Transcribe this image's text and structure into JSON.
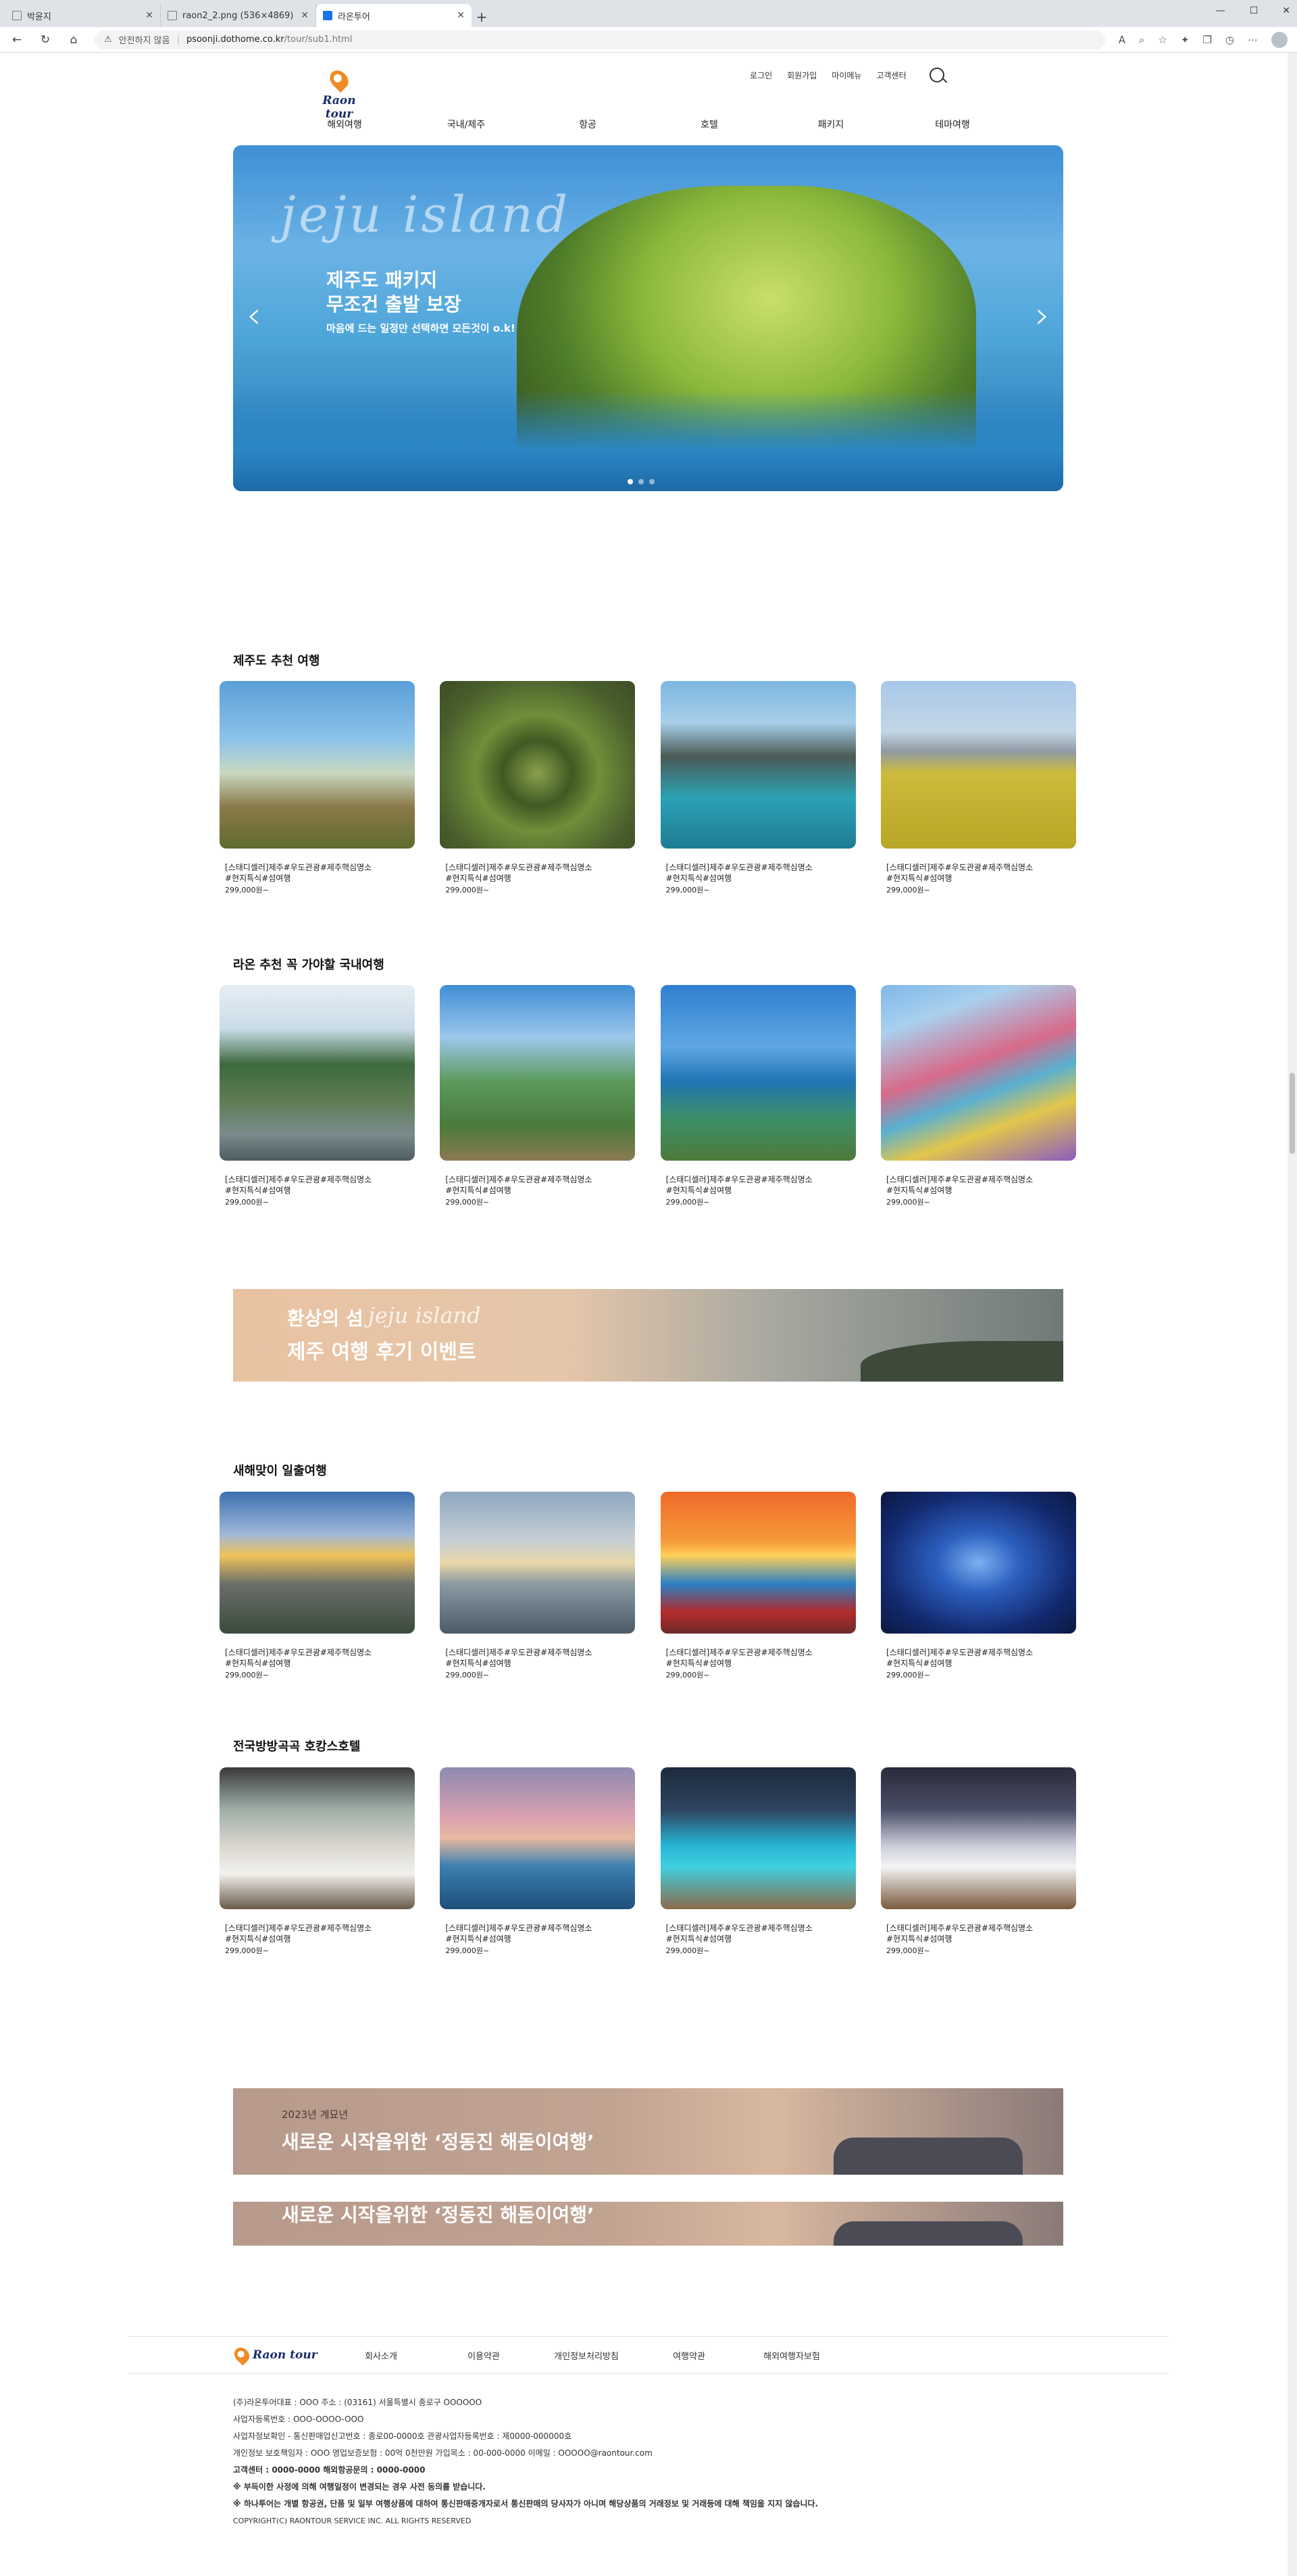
{
  "browser": {
    "tabs": [
      {
        "title": "박윤지",
        "active": false
      },
      {
        "title": "raon2_2.png (536×4869)",
        "active": false
      },
      {
        "title": "라온투어",
        "active": true
      }
    ],
    "security_label": "안전하지 않음",
    "url_host": "psoonji.dothome.co.kr",
    "url_path": "/tour/sub1.html"
  },
  "header": {
    "logo_text": "Raon tour",
    "util_links": [
      "로그인",
      "회원가입",
      "마이메뉴",
      "고객센터"
    ],
    "gnb": [
      "해외여행",
      "국내/제주",
      "항공",
      "호텔",
      "패키지",
      "테마여행"
    ]
  },
  "hero": {
    "script_text": "jeju island",
    "headline_1": "제주도 패키지",
    "headline_2": "무조건 출발 보장",
    "subtext": "마음에 드는 일정만 선택하면 모든것이 o.k!"
  },
  "sections": {
    "s1_title": "제주도 추천 여행",
    "s2_title": "라온 추천 꼭 가야할 국내여행",
    "s3_title": "새해맞이 일출여행",
    "s4_title": "전국방방곡곡 호캉스호텔"
  },
  "product": {
    "line1": "[스태디셀러]제주#우도관광#제주핵심명소",
    "line2": "#현지특식#섬여행",
    "price": "299,000원~"
  },
  "banner1": {
    "line1": "환상의 섬",
    "script": "jeju island",
    "line2": "제주 여행 후기 이벤트"
  },
  "banner2": {
    "small": "2023년 계묘년",
    "main": "새로운 시작을위한 ‘정동진 해돋이여행’"
  },
  "banner3": {
    "main": "새로운 시작을위한 ‘정동진 해돋이여행’"
  },
  "footer": {
    "logo_text": "Raon tour",
    "links": [
      "회사소개",
      "이용약관",
      "개인정보처리방침",
      "여행약관",
      "해외여행자보험"
    ],
    "info": [
      "(주)라온투어대표 : OOO 주소 : (03161) 서울특별시 종로구 OOOOOO",
      "사업자등록번호 : OOO-OOOO-OOO",
      "사업자정보확인 - 통신판매업신고번호 : 종로00-0000호 관광사업자등록번호 : 제0000-000000호",
      "개인정보 보호책임자 : OOO 영업보증보험 : 00억 0천만원 가입목소 : 00-000-0000 이메일 : OOOOO@raontour.com",
      "고객센터 : 0000-0000 해외항공문의 : 0000-0000",
      "※ 부득이한 사정에 의해 여행일정이 변경되는 경우 사전 동의를 받습니다.",
      "※ 하나투어는 개별 항공권, 단품 및 일부 여행상품에 대하여 통신판매중개자로서 통신판매의 당사자가 아니며 해당상품의 거래정보 및 거래등에 대해 책임을 지지 않습니다.",
      "COPYRIGHT(C) RAONTOUR SERVICE INC. ALL RIGHTS RESERVED"
    ]
  },
  "colors": {
    "brand_orange": "#f08a24",
    "brand_navy": "#1a2c6b",
    "banner1_bg": "#e8c3a2",
    "banner2_bg": "#b89a8c"
  }
}
